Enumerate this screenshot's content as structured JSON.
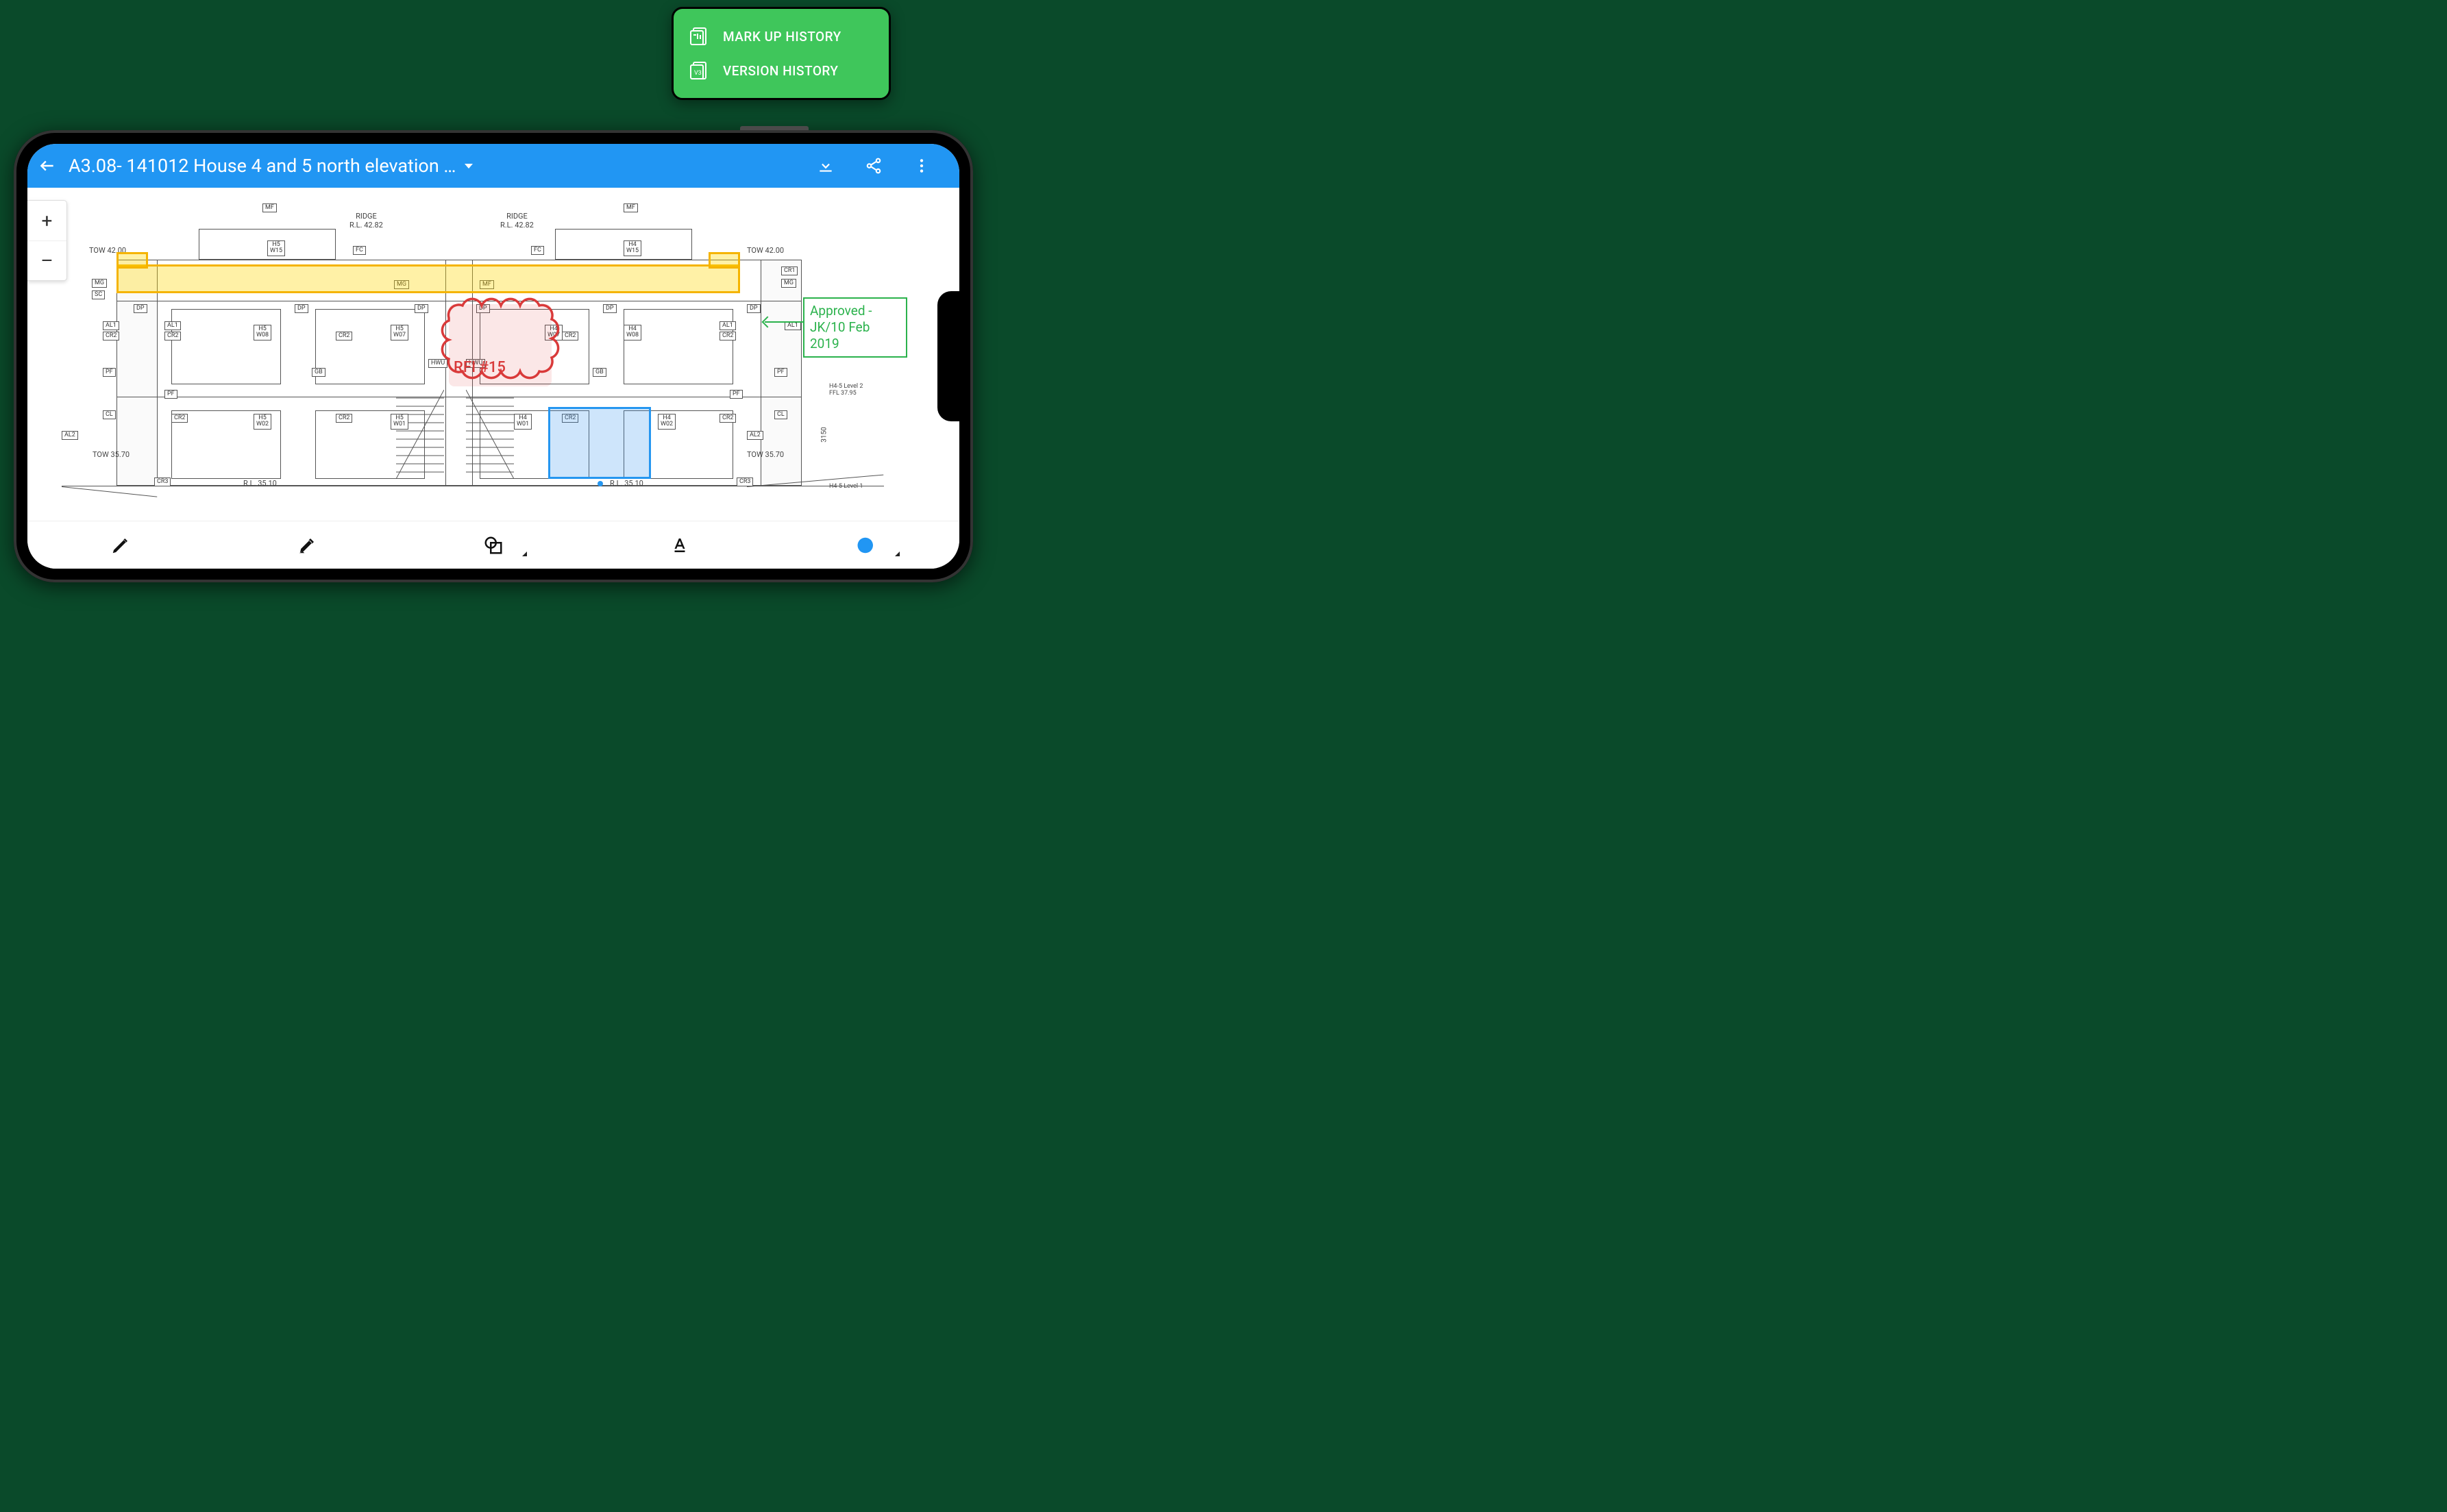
{
  "popup": {
    "markup_history": "MARK UP HISTORY",
    "version_history": "VERSION HISTORY"
  },
  "header": {
    "title": "A3.08- 141012 House 4 and 5 north elevation …"
  },
  "zoom": {
    "in": "+",
    "out": "–"
  },
  "drawing": {
    "ridge1": "RIDGE\nR.L. 42.82",
    "ridge2": "RIDGE\nR.L. 42.82",
    "tow_l": "TOW 42.00",
    "tow_r": "TOW 42.00",
    "tow_bl": "TOW 35.70",
    "tow_br": "TOW 35.70",
    "rl_l": "R.L. 35.10",
    "rl_r": "R.L. 35.10",
    "level2": "H4-5 Level 2\nFFL 37.95",
    "level1": "H4-5 Level 1",
    "dim_3150": "3150",
    "labels": {
      "MF": "MF",
      "MG": "MG",
      "SC": "SC",
      "FC": "FC",
      "DP": "DP",
      "PF": "PF",
      "CL": "CL",
      "GB": "GB",
      "HWU": "HWU",
      "CR1": "CR1",
      "CR2": "CR2",
      "CR3": "CR3",
      "AL1": "AL1",
      "AL2": "AL2",
      "H5W15": "H5\nW15",
      "H4W15": "H4\nW15",
      "H5W07": "H5\nW07",
      "H5W08": "H5\nW08",
      "H4W07": "H4\nW07",
      "H4W08": "H4\nW08",
      "H5W01": "H5\nW01",
      "H5W02": "H5\nW02",
      "H4W01": "H4\nW01",
      "H4W02": "H4\nW02"
    }
  },
  "markups": {
    "cloud_label": "RFI #15",
    "callout_text": "Approved - JK/10 Feb 2019"
  },
  "toolbar": {
    "pen": "pen-tool",
    "highlighter": "highlighter-tool",
    "shape": "shape-tool",
    "text": "text-tool",
    "color": "color-picker"
  }
}
